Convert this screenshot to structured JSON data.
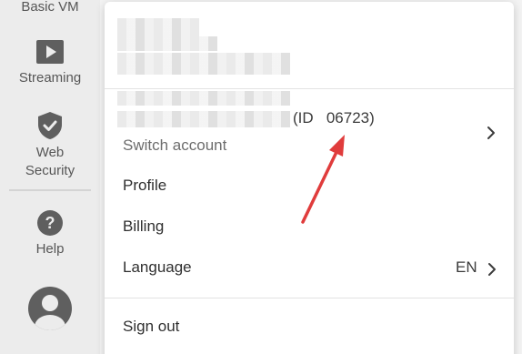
{
  "sidebar": {
    "items": [
      {
        "label": "Basic VM",
        "icon": "server-icon"
      },
      {
        "label": "Streaming",
        "icon": "play-icon"
      },
      {
        "label": "Web Security",
        "icon": "shield-check-icon"
      },
      {
        "label": "Help",
        "icon": "question-icon"
      }
    ],
    "avatar_icon": "user-avatar-icon"
  },
  "account_menu": {
    "account_id_text": "(ID   06723)",
    "switch_account_label": "Switch account",
    "items": [
      {
        "label": "Profile"
      },
      {
        "label": "Billing"
      },
      {
        "label": "Language",
        "value": "EN"
      }
    ],
    "sign_out_label": "Sign out"
  },
  "colors": {
    "sidebar_bg": "#ececec",
    "sidebar_icon": "#5f5f5f",
    "menu_bg": "#ffffff",
    "annotation_arrow": "#e03c3c"
  }
}
